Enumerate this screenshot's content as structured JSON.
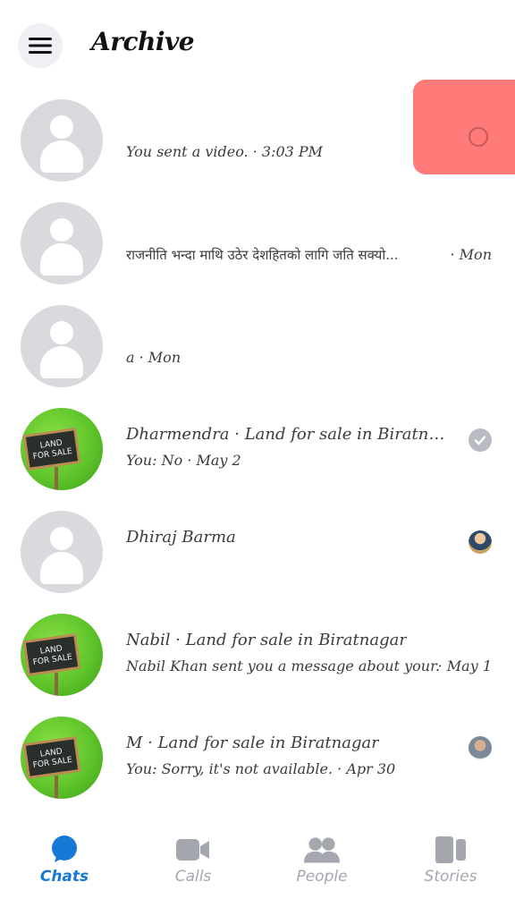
{
  "header": {
    "title": "Archive"
  },
  "chats": [
    {
      "line1": "",
      "line2": "You sent a video. · 3:03 PM",
      "avatar": "placeholder"
    },
    {
      "line1": "",
      "line2": "राजनीति भन्दा माथि उठेर देशहितको लागि जति सक्यो...",
      "right": " · Mon",
      "avatar": "placeholder"
    },
    {
      "line1": "",
      "line2": "a · Mon",
      "avatar": "placeholder"
    },
    {
      "line1": "Dharmendra · Land for sale in Biratna...",
      "line2": "You: No · May 2",
      "avatar": "land",
      "status": "seen-check"
    },
    {
      "line1": "Dhiraj Barma",
      "line2": "",
      "avatar": "placeholder",
      "status": "mini-avatar"
    },
    {
      "line1": "Nabil · Land for sale in Biratnagar",
      "line2": "Nabil Khan sent you a message about your...",
      "right": " · May 1",
      "avatar": "land"
    },
    {
      "line1": "M · Land for sale in Biratnagar",
      "line2": "You: Sorry, it's not available. · Apr 30",
      "avatar": "land",
      "status": "mini-avatar"
    }
  ],
  "land_sign": {
    "line1": "LAND",
    "line2": "FOR SALE"
  },
  "nav": {
    "chats": "Chats",
    "calls": "Calls",
    "people": "People",
    "stories": "Stories"
  },
  "colors": {
    "accent": "#1878d6",
    "inactive": "#a4a8ae",
    "float_box": "#ff7b7a"
  }
}
